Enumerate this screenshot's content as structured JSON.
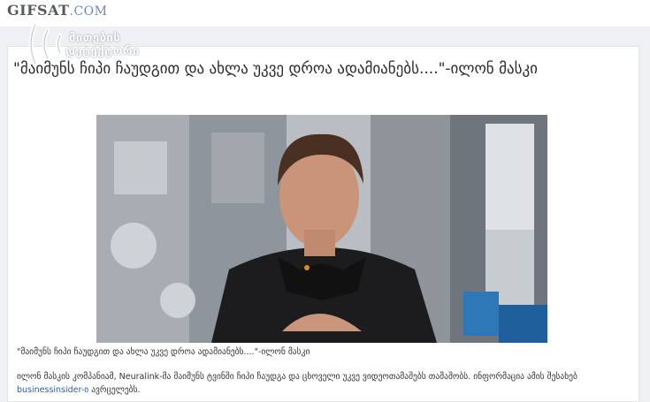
{
  "site": {
    "logo_main": "GIFSAT",
    "logo_tld": ".COM"
  },
  "watermark": {
    "line1": "მითების",
    "line2": "დეტექტორი"
  },
  "article": {
    "title": "\"მაიმუნს ჩიპი ჩაუდგით და ახლა უკვე დროა ადამიანებს....\"-ილონ მასკი",
    "caption": "\"მაიმუნს ჩიპი ჩაუდგით და ახლა უკვე დროა ადამიანებს....\"-ილონ მასკი",
    "body_prefix": "ილონ მასკის კომპანიამ, Neuralink-მა მაიმუნს ტვინში ჩიპი ჩაუდგა და ცხოველი უკვე ვიდეოთამაშებს თამაშობს. ინფორმაცია ამის შესახებ ",
    "body_link": "businessinsider-ი",
    "body_suffix": " ავრცელებს."
  },
  "colors": {
    "link": "#2a5db0",
    "logo_tld": "#6e86b5",
    "page_bg": "#eef0f3"
  }
}
